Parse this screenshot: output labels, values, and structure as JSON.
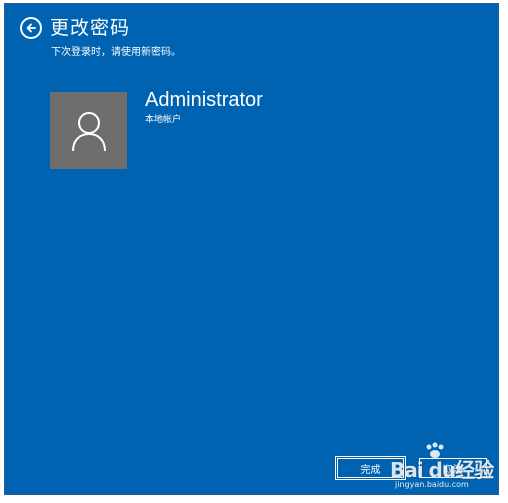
{
  "page": {
    "title": "更改密码",
    "subtitle": "下次登录时，请使用新密码。"
  },
  "user": {
    "name": "Administrator",
    "account_type": "本地帐户"
  },
  "buttons": {
    "done_label": "完成",
    "cancel_label": "取消"
  },
  "watermark": {
    "main": "Bai du经验",
    "sub": "jingyan.baidu.com"
  },
  "colors": {
    "background": "#0063b1",
    "avatar_bg": "#6e6e6e",
    "text": "#ffffff"
  },
  "icons": {
    "back": "back-arrow-circle-icon",
    "avatar": "user-silhouette-icon"
  }
}
